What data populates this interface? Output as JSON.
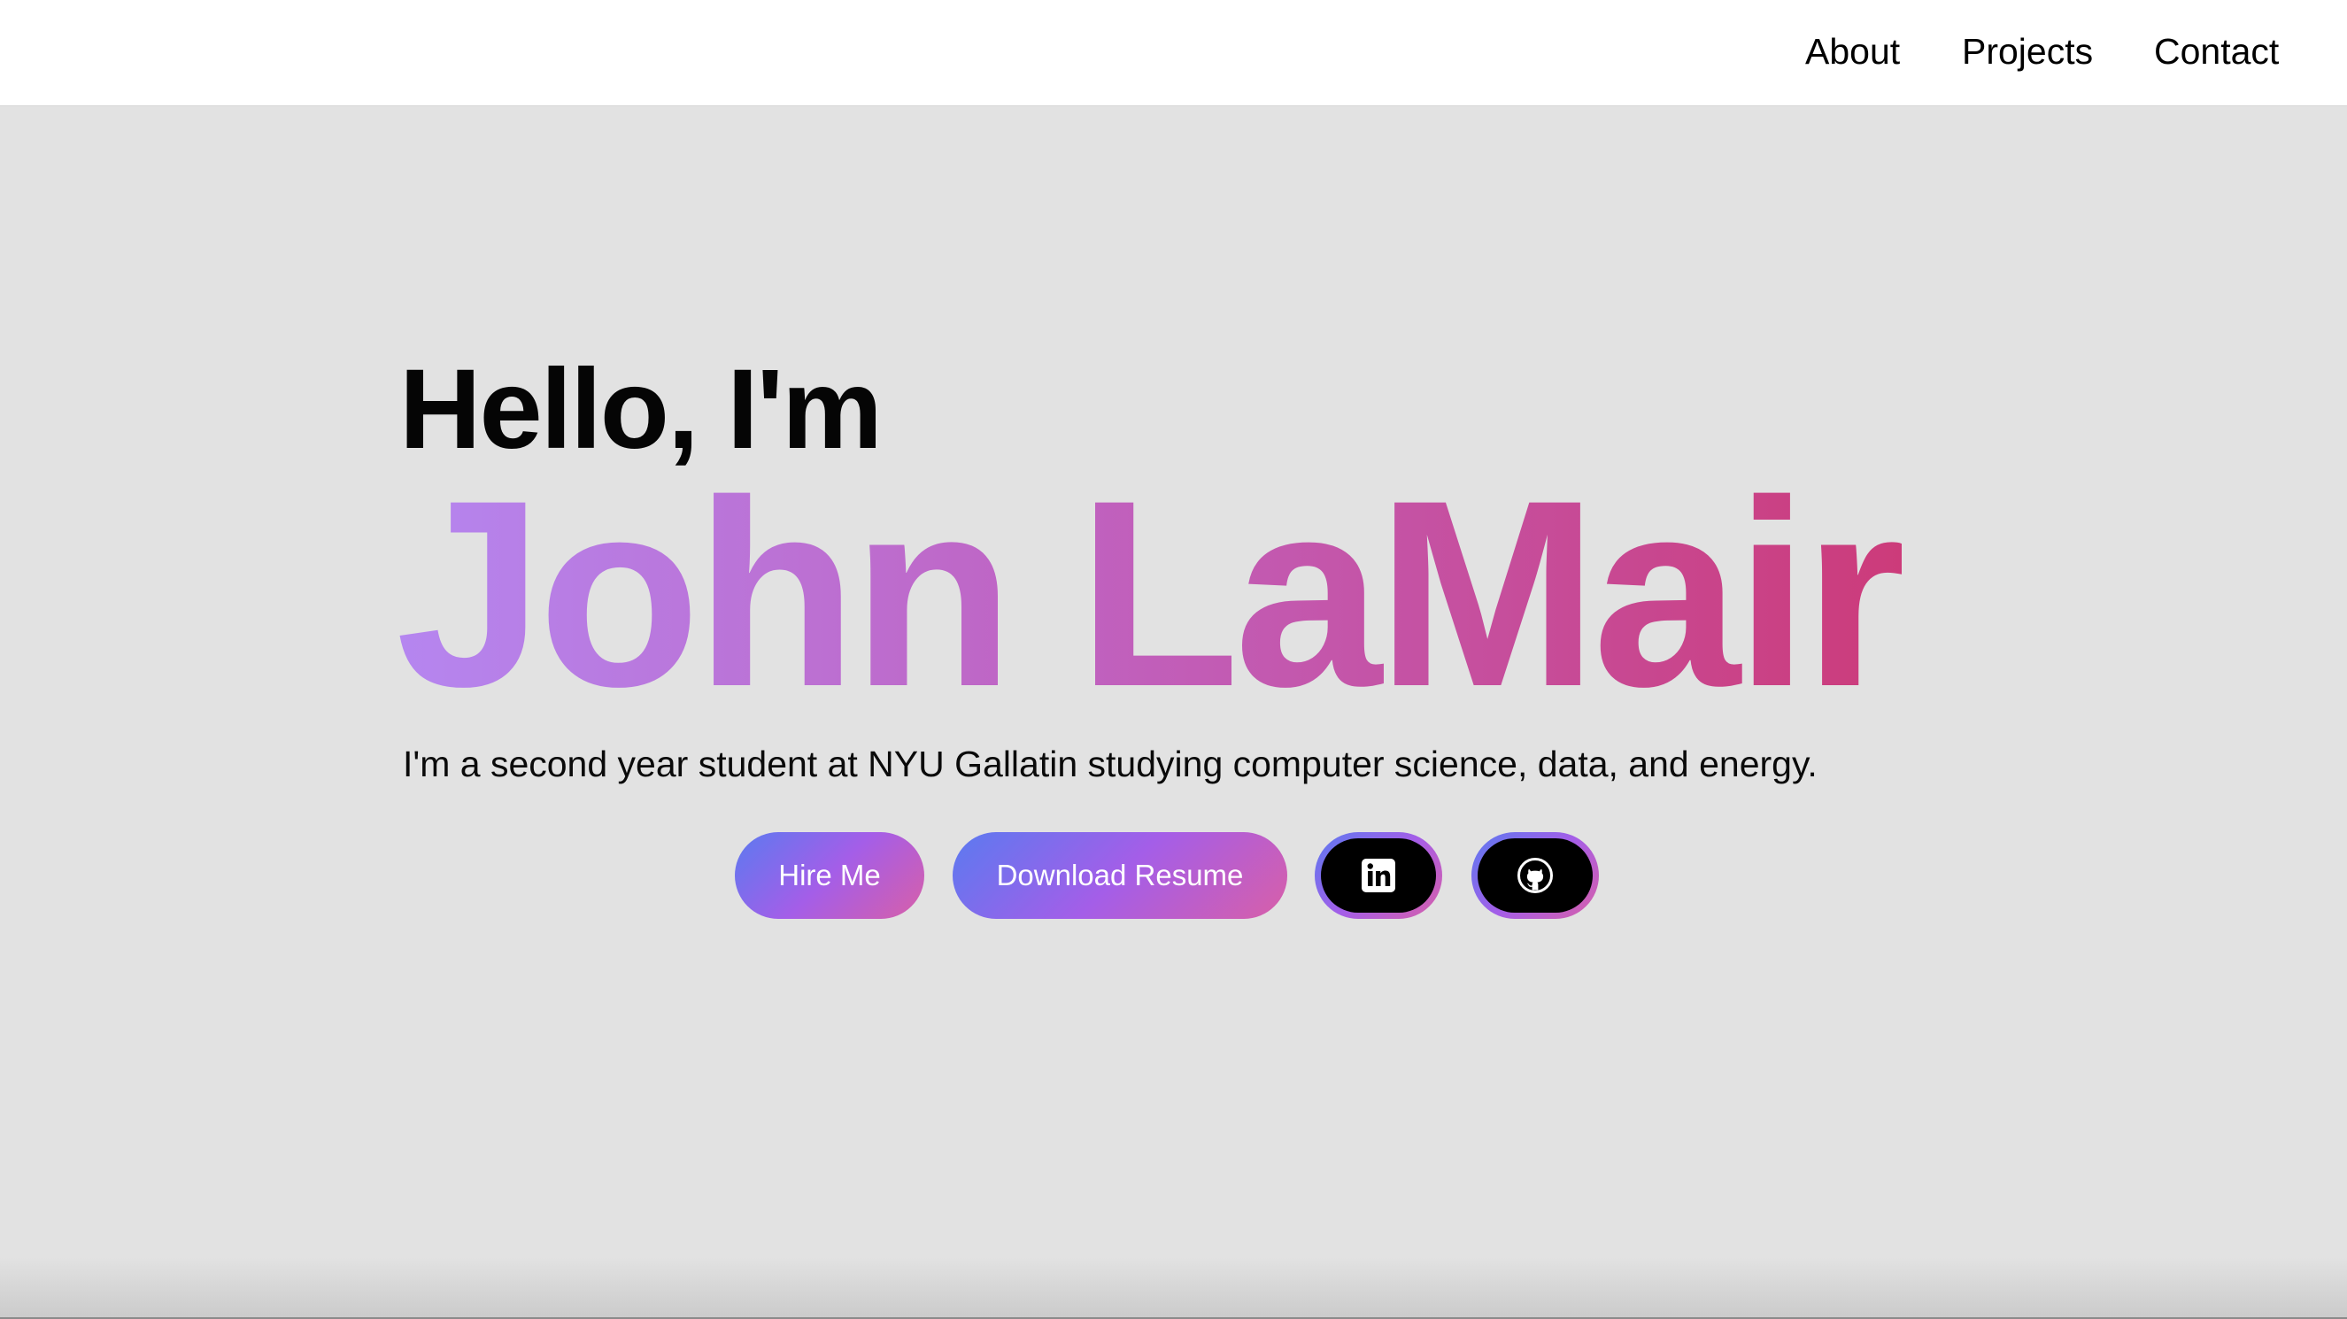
{
  "nav": {
    "items": [
      {
        "label": "About"
      },
      {
        "label": "Projects"
      },
      {
        "label": "Contact"
      }
    ]
  },
  "hero": {
    "greeting": "Hello, I'm",
    "name": "John LaMair",
    "bio": "I'm a second year student at NYU Gallatin studying computer science, data, and energy.",
    "buttons": {
      "hire": "Hire Me",
      "resume": "Download Resume"
    },
    "social": [
      {
        "icon": "linkedin-icon"
      },
      {
        "icon": "github-icon"
      }
    ]
  },
  "colors": {
    "background": "#e2e2e2",
    "nav_background": "#ffffff",
    "name_gradient_start": "#b586f0",
    "name_gradient_mid": "#c062c0",
    "name_gradient_end": "#cc3b7a",
    "button_gradient_start": "#5b7af0",
    "button_gradient_mid": "#a45ee8",
    "button_gradient_end": "#d85fa8"
  }
}
